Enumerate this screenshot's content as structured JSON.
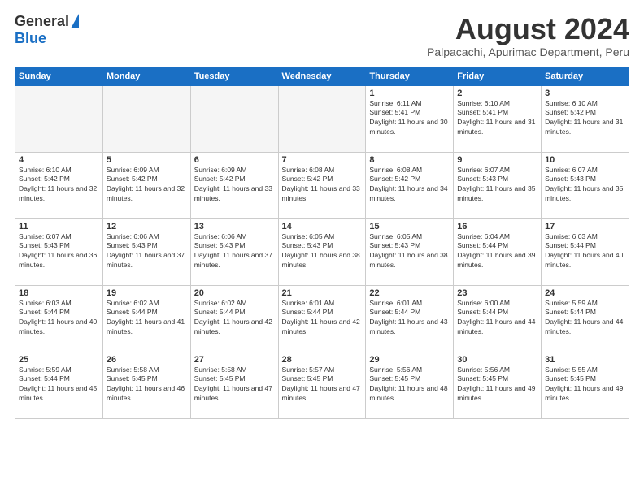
{
  "logo": {
    "general": "General",
    "blue": "Blue"
  },
  "title": "August 2024",
  "location": "Palpacachi, Apurimac Department, Peru",
  "headers": [
    "Sunday",
    "Monday",
    "Tuesday",
    "Wednesday",
    "Thursday",
    "Friday",
    "Saturday"
  ],
  "weeks": [
    [
      {
        "day": "",
        "sunrise": "",
        "sunset": "",
        "daylight": "",
        "empty": true
      },
      {
        "day": "",
        "sunrise": "",
        "sunset": "",
        "daylight": "",
        "empty": true
      },
      {
        "day": "",
        "sunrise": "",
        "sunset": "",
        "daylight": "",
        "empty": true
      },
      {
        "day": "",
        "sunrise": "",
        "sunset": "",
        "daylight": "",
        "empty": true
      },
      {
        "day": "1",
        "sunrise": "6:11 AM",
        "sunset": "5:41 PM",
        "daylight": "11 hours and 30 minutes."
      },
      {
        "day": "2",
        "sunrise": "6:10 AM",
        "sunset": "5:41 PM",
        "daylight": "11 hours and 31 minutes."
      },
      {
        "day": "3",
        "sunrise": "6:10 AM",
        "sunset": "5:42 PM",
        "daylight": "11 hours and 31 minutes."
      }
    ],
    [
      {
        "day": "4",
        "sunrise": "6:10 AM",
        "sunset": "5:42 PM",
        "daylight": "11 hours and 32 minutes."
      },
      {
        "day": "5",
        "sunrise": "6:09 AM",
        "sunset": "5:42 PM",
        "daylight": "11 hours and 32 minutes."
      },
      {
        "day": "6",
        "sunrise": "6:09 AM",
        "sunset": "5:42 PM",
        "daylight": "11 hours and 33 minutes."
      },
      {
        "day": "7",
        "sunrise": "6:08 AM",
        "sunset": "5:42 PM",
        "daylight": "11 hours and 33 minutes."
      },
      {
        "day": "8",
        "sunrise": "6:08 AM",
        "sunset": "5:42 PM",
        "daylight": "11 hours and 34 minutes."
      },
      {
        "day": "9",
        "sunrise": "6:07 AM",
        "sunset": "5:43 PM",
        "daylight": "11 hours and 35 minutes."
      },
      {
        "day": "10",
        "sunrise": "6:07 AM",
        "sunset": "5:43 PM",
        "daylight": "11 hours and 35 minutes."
      }
    ],
    [
      {
        "day": "11",
        "sunrise": "6:07 AM",
        "sunset": "5:43 PM",
        "daylight": "11 hours and 36 minutes."
      },
      {
        "day": "12",
        "sunrise": "6:06 AM",
        "sunset": "5:43 PM",
        "daylight": "11 hours and 37 minutes."
      },
      {
        "day": "13",
        "sunrise": "6:06 AM",
        "sunset": "5:43 PM",
        "daylight": "11 hours and 37 minutes."
      },
      {
        "day": "14",
        "sunrise": "6:05 AM",
        "sunset": "5:43 PM",
        "daylight": "11 hours and 38 minutes."
      },
      {
        "day": "15",
        "sunrise": "6:05 AM",
        "sunset": "5:43 PM",
        "daylight": "11 hours and 38 minutes."
      },
      {
        "day": "16",
        "sunrise": "6:04 AM",
        "sunset": "5:44 PM",
        "daylight": "11 hours and 39 minutes."
      },
      {
        "day": "17",
        "sunrise": "6:03 AM",
        "sunset": "5:44 PM",
        "daylight": "11 hours and 40 minutes."
      }
    ],
    [
      {
        "day": "18",
        "sunrise": "6:03 AM",
        "sunset": "5:44 PM",
        "daylight": "11 hours and 40 minutes."
      },
      {
        "day": "19",
        "sunrise": "6:02 AM",
        "sunset": "5:44 PM",
        "daylight": "11 hours and 41 minutes."
      },
      {
        "day": "20",
        "sunrise": "6:02 AM",
        "sunset": "5:44 PM",
        "daylight": "11 hours and 42 minutes."
      },
      {
        "day": "21",
        "sunrise": "6:01 AM",
        "sunset": "5:44 PM",
        "daylight": "11 hours and 42 minutes."
      },
      {
        "day": "22",
        "sunrise": "6:01 AM",
        "sunset": "5:44 PM",
        "daylight": "11 hours and 43 minutes."
      },
      {
        "day": "23",
        "sunrise": "6:00 AM",
        "sunset": "5:44 PM",
        "daylight": "11 hours and 44 minutes."
      },
      {
        "day": "24",
        "sunrise": "5:59 AM",
        "sunset": "5:44 PM",
        "daylight": "11 hours and 44 minutes."
      }
    ],
    [
      {
        "day": "25",
        "sunrise": "5:59 AM",
        "sunset": "5:44 PM",
        "daylight": "11 hours and 45 minutes."
      },
      {
        "day": "26",
        "sunrise": "5:58 AM",
        "sunset": "5:45 PM",
        "daylight": "11 hours and 46 minutes."
      },
      {
        "day": "27",
        "sunrise": "5:58 AM",
        "sunset": "5:45 PM",
        "daylight": "11 hours and 47 minutes."
      },
      {
        "day": "28",
        "sunrise": "5:57 AM",
        "sunset": "5:45 PM",
        "daylight": "11 hours and 47 minutes."
      },
      {
        "day": "29",
        "sunrise": "5:56 AM",
        "sunset": "5:45 PM",
        "daylight": "11 hours and 48 minutes."
      },
      {
        "day": "30",
        "sunrise": "5:56 AM",
        "sunset": "5:45 PM",
        "daylight": "11 hours and 49 minutes."
      },
      {
        "day": "31",
        "sunrise": "5:55 AM",
        "sunset": "5:45 PM",
        "daylight": "11 hours and 49 minutes."
      }
    ]
  ]
}
